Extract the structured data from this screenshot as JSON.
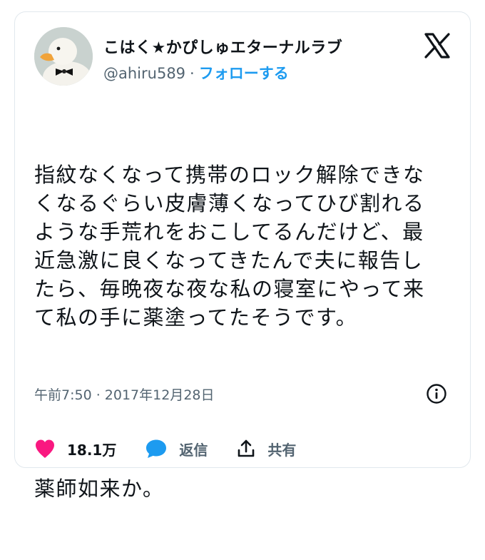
{
  "user": {
    "display_name": "こはく★かぴしゅエターナルラブ",
    "handle": "@ahiru589",
    "separator": "·",
    "follow_label": "フォローする",
    "avatar_icon": "duck-avatar"
  },
  "brand": {
    "logo_icon": "x-logo-icon"
  },
  "tweet": {
    "text": "指紋なくなって携帯のロック解除できなくなるぐらい皮膚薄くなってひび割れるような手荒れをおこしてるんだけど、最近急激に良くなってきたんで夫に報告したら、毎晩夜な夜な私の寝室にやって来て私の手に薬塗ってたそうです。",
    "text2": "薬師如来か。",
    "timestamp": "午前7:50 · 2017年12月28日"
  },
  "actions": {
    "like_count": "18.1万",
    "reply_label": "返信",
    "share_label": "共有"
  },
  "colors": {
    "like": "#f91880",
    "reply": "#1d9bf0",
    "link": "#1d9bf0",
    "muted": "#536471",
    "text": "#0f1419"
  }
}
